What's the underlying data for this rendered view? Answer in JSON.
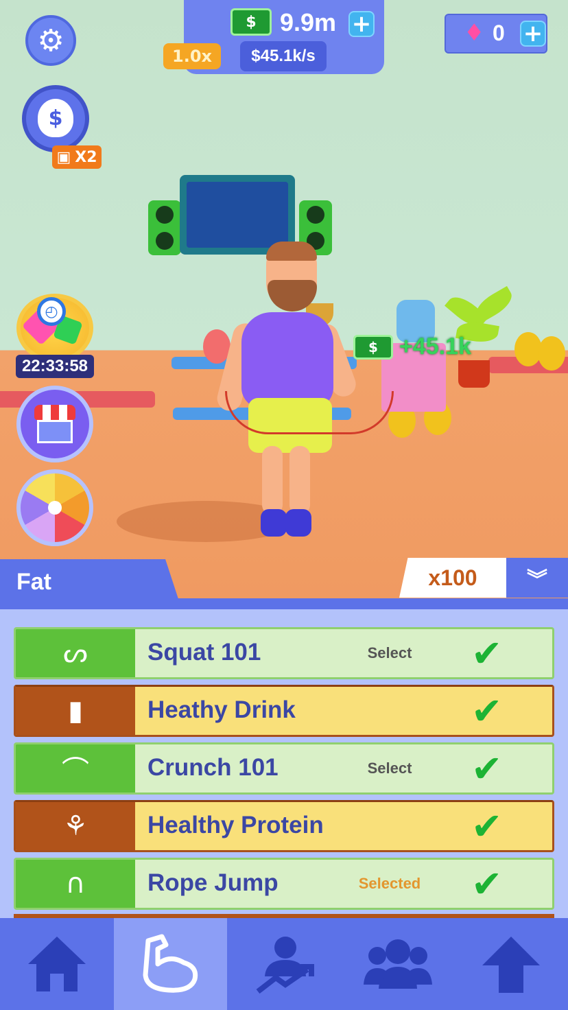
{
  "hud": {
    "cash_value": "9.9m",
    "cash_icon": "$",
    "multiplier": "1.0x",
    "income_rate": "$45.1k/s",
    "gems_value": "0",
    "plus": "+"
  },
  "side": {
    "moneybag_symbol": "$",
    "boost_label": "X2",
    "timer": "22:33:58"
  },
  "floating_income": "+45.1k",
  "panel": {
    "tab_label": "Fat",
    "quantity": "x100"
  },
  "exercises": [
    {
      "label": "Squat 101",
      "status": "Select",
      "icon": "squat-icon",
      "kind": "green"
    },
    {
      "label": "Heathy Drink",
      "status": "",
      "icon": "bottle-icon",
      "kind": "orange"
    },
    {
      "label": "Crunch 101",
      "status": "Select",
      "icon": "crunch-icon",
      "kind": "green"
    },
    {
      "label": "Healthy Protein",
      "status": "",
      "icon": "food-icon",
      "kind": "orange"
    },
    {
      "label": "Rope Jump",
      "status": "Selected",
      "icon": "jump-rope-icon",
      "kind": "green"
    }
  ],
  "nav": [
    "home-icon",
    "muscle-icon",
    "trainer-icon",
    "team-icon",
    "upgrade-arrow-icon"
  ],
  "colors": {
    "accent": "#5c72e8",
    "cash_green": "#1f9a32",
    "check_green": "#1db334",
    "orange_tab": "#f5a623"
  }
}
